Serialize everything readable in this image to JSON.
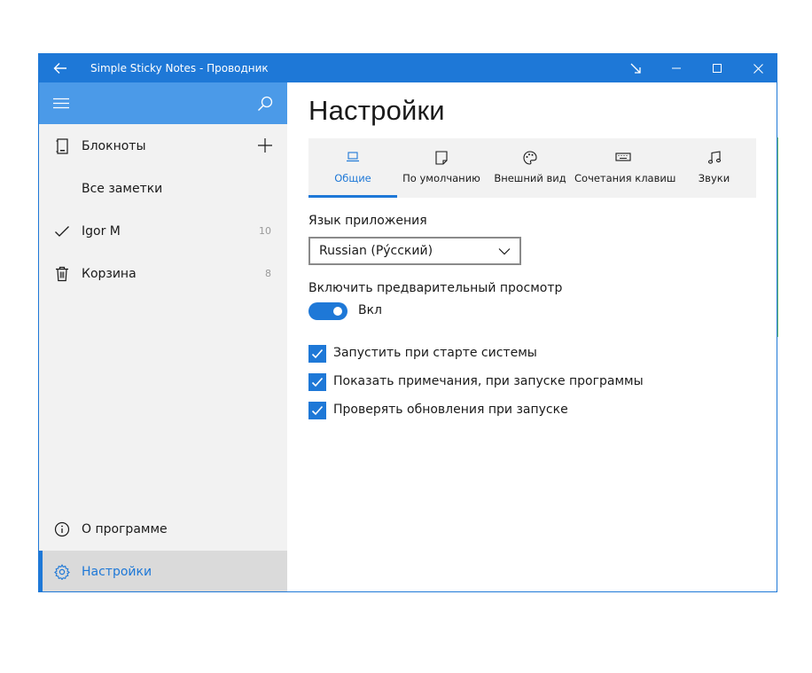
{
  "window": {
    "title": "Simple Sticky Notes - Проводник"
  },
  "sidebar": {
    "items": [
      {
        "label": "Блокноты",
        "icon": "notebook-icon"
      },
      {
        "label": "Все заметки"
      },
      {
        "label": "Igor M",
        "count": "10",
        "icon": "checkmark-icon"
      },
      {
        "label": "Корзина",
        "count": "8",
        "icon": "trash-icon"
      }
    ],
    "bottom": [
      {
        "label": "О программе",
        "icon": "info-icon"
      },
      {
        "label": "Настройки",
        "icon": "gear-icon"
      }
    ]
  },
  "main": {
    "title": "Настройки",
    "tabs": [
      {
        "label": "Общие",
        "icon": "laptop-icon",
        "active": true
      },
      {
        "label": "По умолчанию",
        "icon": "note-icon"
      },
      {
        "label": "Внешний вид",
        "icon": "palette-icon"
      },
      {
        "label": "Сочетания клавиш",
        "icon": "keyboard-icon"
      },
      {
        "label": "Звуки",
        "icon": "music-icon"
      }
    ],
    "language_label": "Язык приложения",
    "language_value": "Russian (Ру́сский)",
    "preview_label": "Включить предварительный просмотр",
    "preview_toggle": "Вкл",
    "checkboxes": [
      {
        "label": "Запустить при старте системы",
        "checked": true
      },
      {
        "label": "Показать примечания, при запуске программы",
        "checked": true
      },
      {
        "label": "Проверять обновления при запуске",
        "checked": true
      }
    ]
  },
  "colors": {
    "accent": "#1e78d7",
    "sidebar_header": "#4b9ae8",
    "sidebar_bg": "#f2f2f2"
  }
}
